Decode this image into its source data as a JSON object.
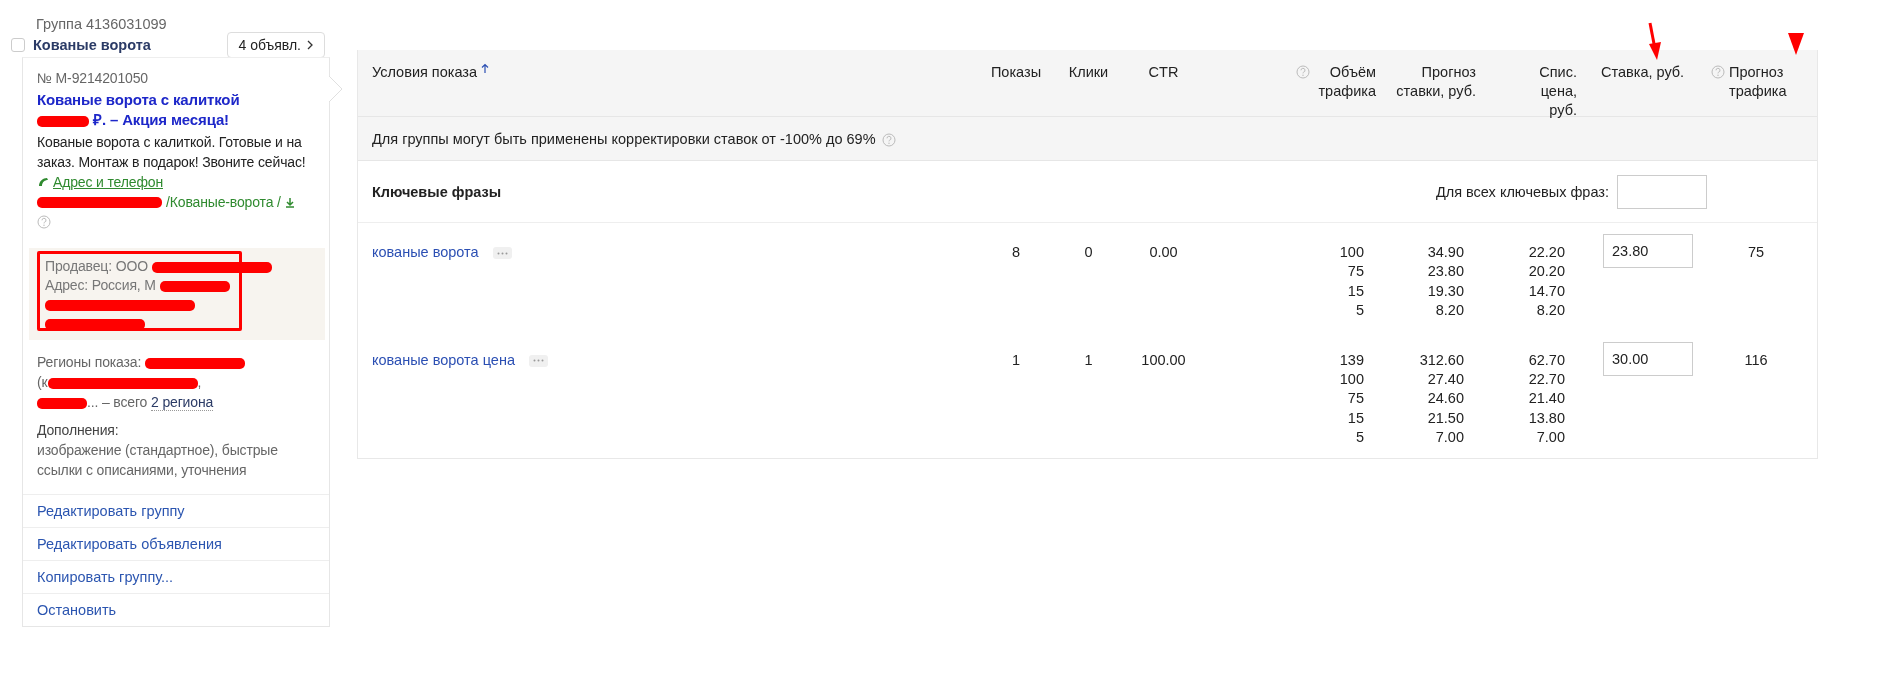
{
  "group": {
    "label": "Группа 4136031099",
    "title": "Кованые ворота",
    "checked": false,
    "ads_button": "4 объявл."
  },
  "ad": {
    "number": "№ M-9214201050",
    "title_line1": "Кованые ворота с калиткой",
    "title_line2": "₽. – Акция месяца!",
    "text": "Кованые ворота с калиткой. Готовые и на заказ. Монтаж в подарок! Звоните сейчас!",
    "contacts_link": "Адрес и телефон",
    "url": "/Кованые-ворота /",
    "seller_lines": [
      "Продавец: ООО",
      "Адрес: Россия, М"
    ],
    "regions": {
      "label": "Регионы показа:",
      "line2_start": "(к",
      "line2_end": ",",
      "line3_end": "... – всего",
      "link": "2 региона"
    },
    "extras_label": "Дополнения:",
    "extras": "изображение (стандартное), быстрые ссылки с описаниями, уточнения"
  },
  "actions": [
    "Редактировать группу",
    "Редактировать объявления",
    "Копировать группу...",
    "Остановить"
  ],
  "table": {
    "columns": [
      {
        "label": "Условия показа",
        "help": false,
        "sorted": true
      },
      {
        "label": "Показы",
        "help": false,
        "sorted": false
      },
      {
        "label": "Клики",
        "help": false,
        "sorted": false
      },
      {
        "label": "CTR",
        "help": false,
        "sorted": false
      },
      {
        "label": "Объём трафика",
        "help": true,
        "sorted": false
      },
      {
        "label": "Прогноз ставки, руб.",
        "help": false,
        "sorted": false
      },
      {
        "label": "Спис. цена, руб.",
        "help": false,
        "sorted": false
      },
      {
        "label": "Ставка, руб.",
        "help": false,
        "sorted": false
      },
      {
        "label": "Прогноз трафика",
        "help": true,
        "sorted": false
      }
    ],
    "adjustment_note": "Для группы могут быть применены корректировки ставок от -100% до 69%",
    "keywords_title": "Ключевые фразы",
    "all_keywords_label": "Для всех ключевых фраз:",
    "rows": [
      {
        "phrase": "кованые ворота",
        "shows": "8",
        "clicks": "0",
        "ctr": "0.00",
        "volumes": [
          "100",
          "75",
          "15",
          "5"
        ],
        "forecasts": [
          "34.90",
          "23.80",
          "19.30",
          "8.20"
        ],
        "list_prices": [
          "22.20",
          "20.20",
          "14.70",
          "8.20"
        ],
        "bid": "23.80",
        "traffic": "75"
      },
      {
        "phrase": "кованые ворота цена",
        "shows": "1",
        "clicks": "1",
        "ctr": "100.00",
        "volumes": [
          "139",
          "100",
          "75",
          "15",
          "5"
        ],
        "forecasts": [
          "312.60",
          "27.40",
          "24.60",
          "21.50",
          "7.00"
        ],
        "list_prices": [
          "62.70",
          "22.70",
          "21.40",
          "13.80",
          "7.00"
        ],
        "bid": "30.00",
        "traffic": "116"
      }
    ]
  }
}
